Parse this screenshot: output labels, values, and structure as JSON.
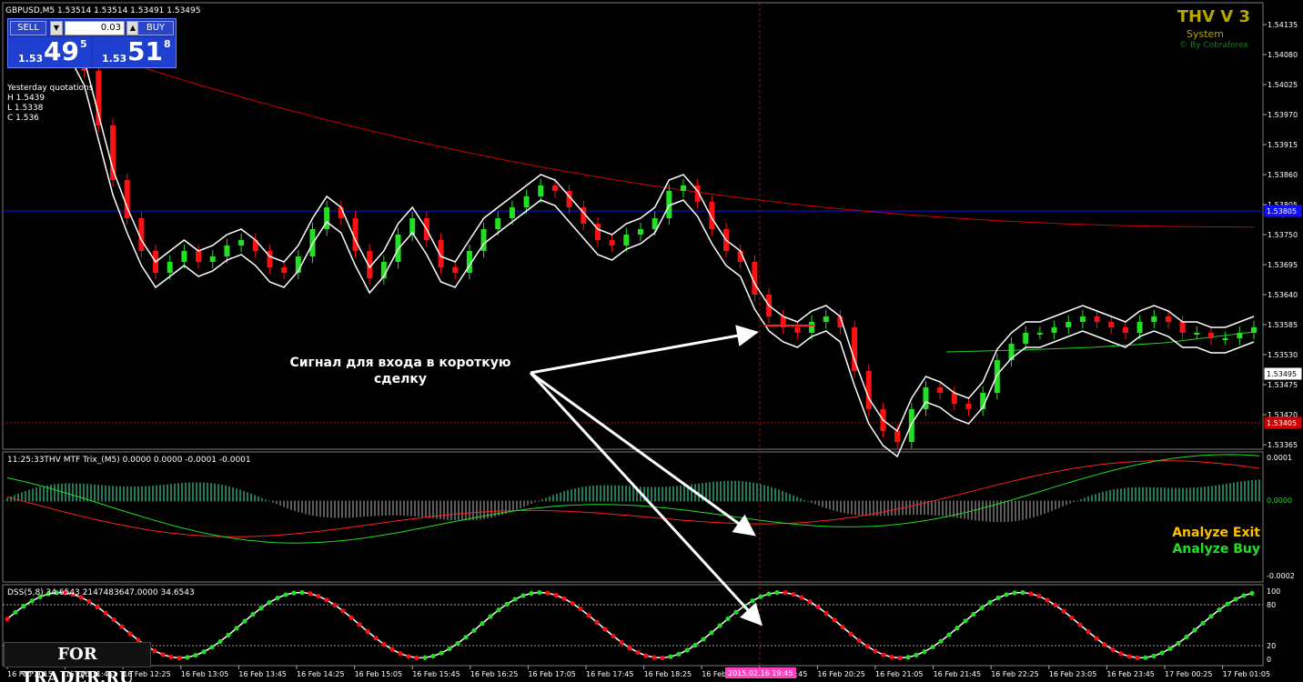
{
  "symbol_header": "GBPUSD,M5  1.53514 1.53514 1.53491 1.53495",
  "trade_panel": {
    "sell_label": "SELL",
    "buy_label": "BUY",
    "lot": "0.03",
    "sell_prefix": "1.53",
    "sell_big": "49",
    "sell_sup": "5",
    "buy_prefix": "1.53",
    "buy_big": "51",
    "buy_sup": "8"
  },
  "yesterday": {
    "title": "Yesterday quotations",
    "high": "H 1.5439",
    "low": "L 1.5338",
    "close": "C 1.536"
  },
  "brand": {
    "title": "THV V 3",
    "subtitle": "System",
    "by": "© By Cobraforex"
  },
  "price_axis_labels": [
    "1.54135",
    "1.54080",
    "1.54025",
    "1.53970",
    "1.53915",
    "1.53860",
    "1.53805",
    "1.53750",
    "1.53695",
    "1.53640",
    "1.53585",
    "1.53530",
    "1.53475",
    "1.53420",
    "1.53365"
  ],
  "price_badges": {
    "current": "1.53495",
    "blue_line": "1.53805",
    "red_line": "1.53405"
  },
  "annotation": {
    "line1": "Сигнал для входа в короткую",
    "line2": "сделку"
  },
  "trix_panel": {
    "header": "11:25:33THV MTF Trix_(M5) 0.0000 0.0000 -0.0001 -0.0001",
    "axis_top": "0.0001",
    "axis_zero": "0.0000",
    "axis_bottom": "-0.0002",
    "analyze_exit": "Analyze Exit",
    "analyze_buy": "Analyze Buy"
  },
  "dss_panel": {
    "header": "DSS(5,8) 34.6543 2147483647.0000 34.6543",
    "axis": [
      "100",
      "80",
      "20",
      "0"
    ]
  },
  "time_axis": [
    "16 Feb 2015",
    "16 Feb 11:45",
    "16 Feb 12:25",
    "16 Feb 13:05",
    "16 Feb 13:45",
    "16 Feb 14:25",
    "16 Feb 15:05",
    "16 Feb 15:45",
    "16 Feb 16:25",
    "16 Feb 17:05",
    "16 Feb 17:45",
    "16 Feb 18:25",
    "16 Feb 19:05",
    "16 Feb 19:45",
    "16 Feb 20:25",
    "16 Feb 21:05",
    "16 Feb 21:45",
    "16 Feb 22:25",
    "16 Feb 23:05",
    "16 Feb 23:45",
    "17 Feb 00:25",
    "17 Feb 01:05"
  ],
  "cursor_time": "2015.02.16 19:45",
  "watermark": "FOR TRADER.RU",
  "colors": {
    "bull": "#22e022",
    "bear": "#ff1010",
    "envelope": "#ffffff",
    "ma_red": "#d00000",
    "ma_green": "#22cc22",
    "blue_line": "#1010ff",
    "trix_hist_pos": "#1d7a5a",
    "trix_hist_neg": "#5a5a5a",
    "dss_line": "#ffffff"
  },
  "chart_data": {
    "type": "line",
    "title": "GBPUSD,M5",
    "price_series": [
      1.541,
      1.5405,
      1.5395,
      1.5385,
      1.5378,
      1.5372,
      1.5368,
      1.537,
      1.5372,
      1.537,
      1.5371,
      1.5373,
      1.5374,
      1.5372,
      1.5369,
      1.5368,
      1.5371,
      1.5376,
      1.538,
      1.5378,
      1.5372,
      1.5367,
      1.537,
      1.5375,
      1.5378,
      1.5374,
      1.5369,
      1.5368,
      1.5372,
      1.5376,
      1.5378,
      1.538,
      1.5382,
      1.5384,
      1.5383,
      1.538,
      1.5377,
      1.5374,
      1.5373,
      1.5375,
      1.5376,
      1.5378,
      1.5383,
      1.5384,
      1.5381,
      1.5376,
      1.5372,
      1.537,
      1.5364,
      1.536,
      1.5358,
      1.5357,
      1.5359,
      1.536,
      1.5358,
      1.535,
      1.5343,
      1.5339,
      1.5337,
      1.5343,
      1.5347,
      1.5346,
      1.5344,
      1.5343,
      1.5346,
      1.5352,
      1.5355,
      1.5357,
      1.5357,
      1.5358,
      1.5359,
      1.536,
      1.5359,
      1.5358,
      1.5357,
      1.5359,
      1.536,
      1.5359,
      1.5357,
      1.5357,
      1.5356,
      1.5356,
      1.5357,
      1.5358
    ],
    "ylim": [
      1.5336,
      1.5415
    ]
  }
}
